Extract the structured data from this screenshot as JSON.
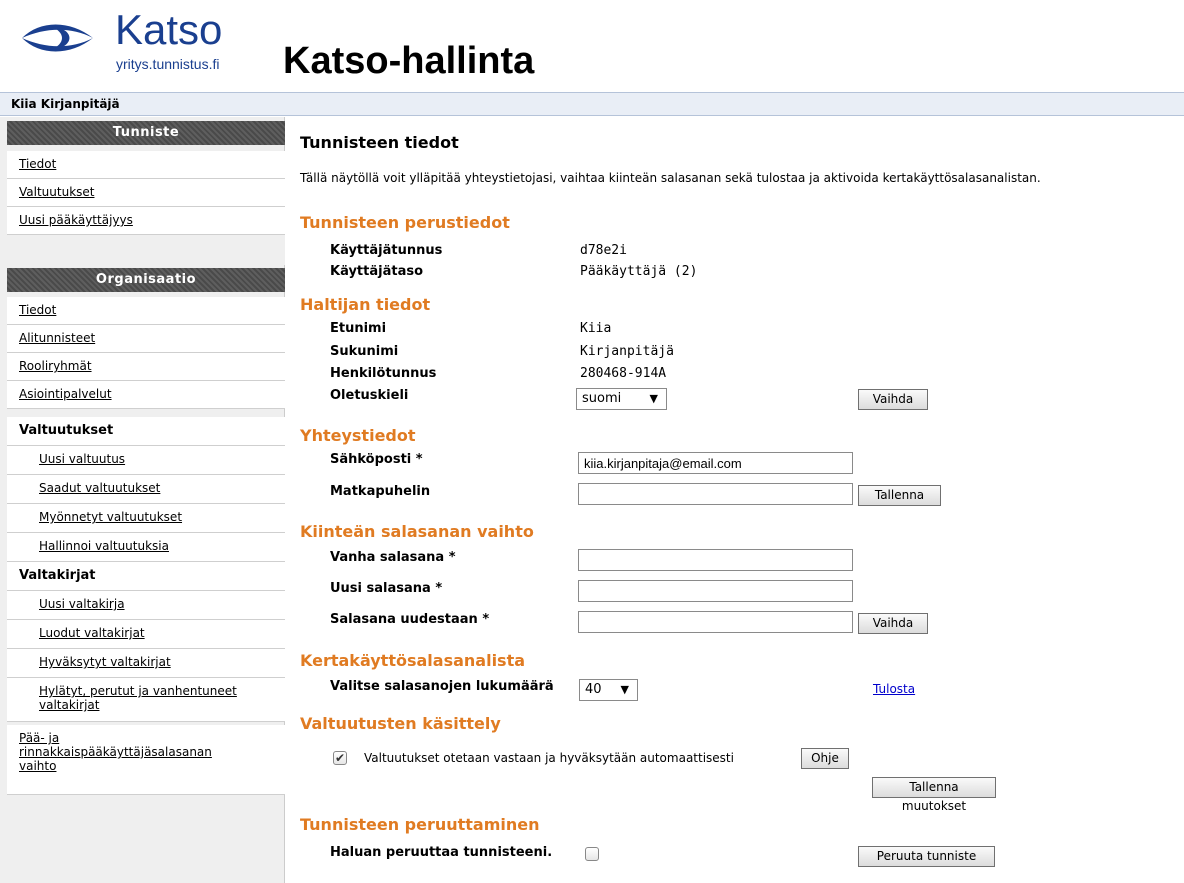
{
  "header": {
    "logo_word": "Katso",
    "logo_sub": "yritys.tunnistus.fi",
    "app_title": "Katso-hallinta",
    "user_name": "Kiia Kirjanpitäjä",
    "brand_color": "#1a3f8f"
  },
  "sidebar": {
    "tunniste_head": "Tunniste",
    "tunniste_items": [
      "Tiedot",
      "Valtuutukset",
      "Uusi pääkäyttäjyys"
    ],
    "org_head": "Organisaatio",
    "org_items": [
      "Tiedot",
      "Alitunnisteet",
      "Rooliryhmät",
      "Asiointipalvelut"
    ],
    "valtuutukset_group": "Valtuutukset",
    "valtuutukset_items": [
      "Uusi valtuutus",
      "Saadut valtuutukset",
      "Myönnetyt valtuutukset",
      "Hallinnoi valtuutuksia"
    ],
    "valtakirjat_group": "Valtakirjat",
    "valtakirjat_items": [
      "Uusi valtakirja",
      "Luodut valtakirjat",
      "Hyväksytyt valtakirjat",
      "Hylätyt, perutut ja vanhentuneet",
      "valtakirjat"
    ],
    "last_item_lines": [
      "Pää- ja",
      "rinnakkaispääkäyttäjäsalasanan",
      "vaihto"
    ]
  },
  "main": {
    "title": "Tunnisteen tiedot",
    "intro": "Tällä näytöllä voit ylläpitää yhteystietojasi, vaihtaa kiinteän salasanan sekä tulostaa ja aktivoida kertakäyttösalasanalistan.",
    "perustiedot": {
      "heading": "Tunnisteen perustiedot",
      "kayttajatunnus_label": "Käyttäjätunnus",
      "kayttajatunnus_value": "d78e2i",
      "kayttajataso_label": "Käyttäjätaso",
      "kayttajataso_value": "Pääkäyttäjä (2)"
    },
    "haltija": {
      "heading": "Haltijan tiedot",
      "etunimi_label": "Etunimi",
      "etunimi_value": "Kiia",
      "sukunimi_label": "Sukunimi",
      "sukunimi_value": "Kirjanpitäjä",
      "hetu_label": "Henkilötunnus",
      "hetu_value": "280468-914A",
      "kieli_label": "Oletuskieli",
      "kieli_value": "suomi",
      "vaihda_button": "Vaihda"
    },
    "yhteystiedot": {
      "heading": "Yhteystiedot",
      "email_label": "Sähköposti *",
      "email_value": "kiia.kirjanpitaja@email.com",
      "phone_label": "Matkapuhelin",
      "phone_value": "",
      "save_button": "Tallenna"
    },
    "salasana": {
      "heading": "Kiinteän salasanan vaihto",
      "old_label": "Vanha salasana *",
      "new_label": "Uusi salasana *",
      "again_label": "Salasana uudestaan *",
      "vaihda_button": "Vaihda"
    },
    "kertakaytto": {
      "heading": "Kertakäyttösalasanalista",
      "count_label": "Valitse salasanojen lukumäärä",
      "count_value": "40",
      "print_link": "Tulosta"
    },
    "valtuutusten": {
      "heading": "Valtuutusten käsittely",
      "auto_label": "Valtuutukset otetaan vastaan ja hyväksytään automaattisesti",
      "auto_checked": true,
      "help_button": "Ohje",
      "save_changes_button": "Tallenna muutokset"
    },
    "peruuttaminen": {
      "heading": "Tunnisteen peruuttaminen",
      "cancel_label": "Haluan peruuttaa tunnisteeni.",
      "cancel_button": "Peruuta tunniste"
    },
    "section_color": "#e07b22"
  }
}
